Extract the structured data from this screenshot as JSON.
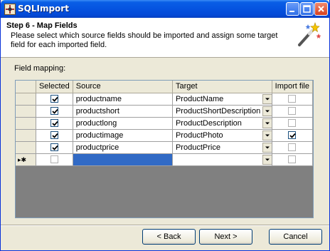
{
  "window": {
    "title": "SQLImport"
  },
  "header": {
    "step_title": "Step 6 - Map Fields",
    "description": "Please select which source fields should be imported and assign some target field for each imported field."
  },
  "group_label": "Field mapping:",
  "grid": {
    "columns": [
      "Selected",
      "Source",
      "Target",
      "Import file"
    ],
    "rows": [
      {
        "selected": true,
        "source": "productname",
        "target": "ProductName",
        "import_file": false
      },
      {
        "selected": true,
        "source": "productshort",
        "target": "ProductShortDescription",
        "import_file": false
      },
      {
        "selected": true,
        "source": "productlong",
        "target": "ProductDescription",
        "import_file": false
      },
      {
        "selected": true,
        "source": "productimage",
        "target": "ProductPhoto",
        "import_file": true
      },
      {
        "selected": true,
        "source": "productprice",
        "target": "ProductPrice",
        "import_file": false
      }
    ],
    "new_row": {
      "marker": "▸✱",
      "selected": false,
      "source": "",
      "target": "",
      "import_file": false
    }
  },
  "buttons": {
    "back": "< Back",
    "next": "Next >",
    "cancel": "Cancel"
  },
  "colors": {
    "titlebar": "#0553e0",
    "selection": "#316ac5",
    "grid_background": "#808080"
  }
}
